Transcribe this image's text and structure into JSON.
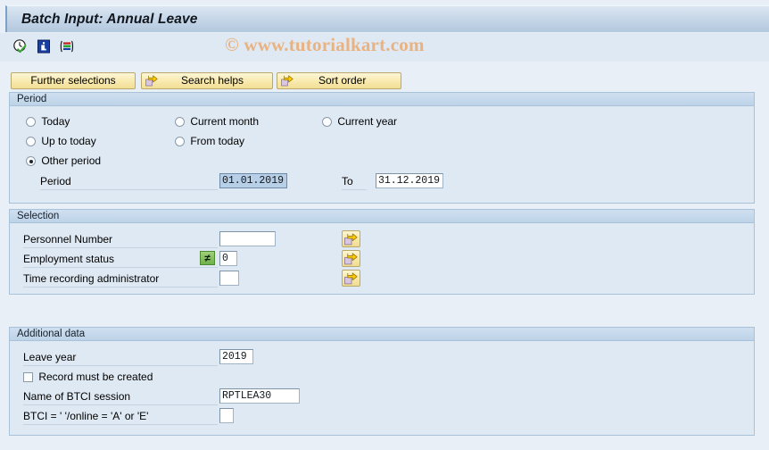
{
  "window": {
    "title": "Batch Input: Annual Leave"
  },
  "watermark": {
    "text": "© www.tutorialkart.com"
  },
  "toolbar": {
    "icons": [
      {
        "name": "execute-clock-check-icon"
      },
      {
        "name": "info-icon"
      },
      {
        "name": "variant-stripes-icon"
      }
    ]
  },
  "buttons": [
    {
      "label": "Further selections",
      "icon": null
    },
    {
      "label": "Search helps",
      "icon": "arrow-right-icon"
    },
    {
      "label": "Sort order",
      "icon": "arrow-right-icon"
    }
  ],
  "period": {
    "header": "Period",
    "options": [
      {
        "label": "Today",
        "selected": false
      },
      {
        "label": "Current month",
        "selected": false
      },
      {
        "label": "Current year",
        "selected": false
      },
      {
        "label": "Up to today",
        "selected": false
      },
      {
        "label": "From today",
        "selected": false
      },
      {
        "label": "Other period",
        "selected": true
      }
    ],
    "period_label": "Period",
    "period_from": "01.01.2019",
    "to_label": "To",
    "period_to": "31.12.2019"
  },
  "selection": {
    "header": "Selection",
    "rows": [
      {
        "label": "Personnel Number",
        "value": "",
        "operator": null
      },
      {
        "label": "Employment status",
        "value": "0",
        "operator": "≠"
      },
      {
        "label": "Time recording administrator",
        "value": "",
        "operator": null
      }
    ],
    "multi_button_icon": "arrow-right-icon"
  },
  "additional": {
    "header": "Additional data",
    "leave_year_label": "Leave year",
    "leave_year_value": "2019",
    "record_checkbox_label": "Record must be created",
    "record_checkbox_checked": false,
    "btci_session_label": "Name of BTCI session",
    "btci_session_value": "RPTLEA30",
    "btci_online_label": "BTCI = ' '/online = 'A' or 'E'",
    "btci_online_value": ""
  }
}
